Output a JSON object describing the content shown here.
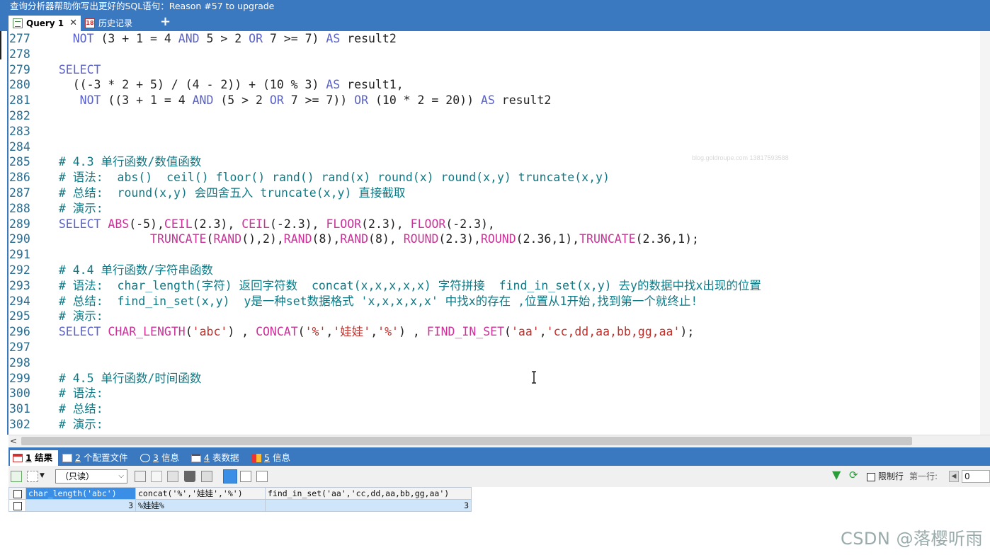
{
  "window": {
    "title": "查询分析器帮助你写出更好的SQL语句：Reason #57 to upgrade"
  },
  "tabs": [
    {
      "label": "Query 1",
      "close": "✕"
    },
    {
      "label": "历史记录",
      "icon_text": "18"
    }
  ],
  "new_tab": "+",
  "editor": {
    "watermark": "blog.goldroupe.com 13817593588",
    "lines": [
      {
        "n": "277",
        "tokens": [
          {
            "t": "    ",
            "c": "pl"
          },
          {
            "t": "NOT",
            "c": "kw"
          },
          {
            "t": " (3 + 1 = 4 ",
            "c": "pl"
          },
          {
            "t": "AND",
            "c": "kw"
          },
          {
            "t": " 5 > 2 ",
            "c": "pl"
          },
          {
            "t": "OR",
            "c": "kw"
          },
          {
            "t": " 7 >= 7) ",
            "c": "pl"
          },
          {
            "t": "AS",
            "c": "kw"
          },
          {
            "t": " result2",
            "c": "pl"
          }
        ]
      },
      {
        "n": "278",
        "tokens": []
      },
      {
        "n": "279",
        "tokens": [
          {
            "t": "  ",
            "c": "pl"
          },
          {
            "t": "SELECT",
            "c": "kw"
          }
        ]
      },
      {
        "n": "280",
        "tokens": [
          {
            "t": "    ((-3 * 2 + 5) / (4 - 2)) + (10 % 3) ",
            "c": "pl"
          },
          {
            "t": "AS",
            "c": "kw"
          },
          {
            "t": " result1,",
            "c": "pl"
          }
        ]
      },
      {
        "n": "281",
        "tokens": [
          {
            "t": "     ",
            "c": "pl"
          },
          {
            "t": "NOT",
            "c": "kw"
          },
          {
            "t": " ((3 + 1 = 4 ",
            "c": "pl"
          },
          {
            "t": "AND",
            "c": "kw"
          },
          {
            "t": " (5 > 2 ",
            "c": "pl"
          },
          {
            "t": "OR",
            "c": "kw"
          },
          {
            "t": " 7 >= 7)) ",
            "c": "pl"
          },
          {
            "t": "OR",
            "c": "kw"
          },
          {
            "t": " (10 * 2 = 20)) ",
            "c": "pl"
          },
          {
            "t": "AS",
            "c": "kw"
          },
          {
            "t": " result2",
            "c": "pl"
          }
        ]
      },
      {
        "n": "282",
        "tokens": []
      },
      {
        "n": "283",
        "tokens": []
      },
      {
        "n": "284",
        "tokens": []
      },
      {
        "n": "285",
        "tokens": [
          {
            "t": "  # 4.3 单行函数/数值函数",
            "c": "cm"
          }
        ]
      },
      {
        "n": "286",
        "tokens": [
          {
            "t": "  # 语法:  abs()  ceil() floor() rand() rand(x) round(x) round(x,y) truncate(x,y)",
            "c": "cm"
          }
        ]
      },
      {
        "n": "287",
        "tokens": [
          {
            "t": "  # 总结:  round(x,y) 会四舍五入 truncate(x,y) 直接截取",
            "c": "cm"
          }
        ]
      },
      {
        "n": "288",
        "tokens": [
          {
            "t": "  # 演示:",
            "c": "cm"
          }
        ]
      },
      {
        "n": "289",
        "tokens": [
          {
            "t": "  ",
            "c": "pl"
          },
          {
            "t": "SELECT",
            "c": "kw"
          },
          {
            "t": " ",
            "c": "pl"
          },
          {
            "t": "ABS",
            "c": "fn"
          },
          {
            "t": "(-5),",
            "c": "pl"
          },
          {
            "t": "CEIL",
            "c": "fn"
          },
          {
            "t": "(2.3), ",
            "c": "pl"
          },
          {
            "t": "CEIL",
            "c": "fn"
          },
          {
            "t": "(-2.3), ",
            "c": "pl"
          },
          {
            "t": "FLOOR",
            "c": "fn"
          },
          {
            "t": "(2.3), ",
            "c": "pl"
          },
          {
            "t": "FLOOR",
            "c": "fn"
          },
          {
            "t": "(-2.3),",
            "c": "pl"
          }
        ]
      },
      {
        "n": "290",
        "tokens": [
          {
            "t": "               ",
            "c": "pl"
          },
          {
            "t": "TRUNCATE",
            "c": "fn"
          },
          {
            "t": "(",
            "c": "pl"
          },
          {
            "t": "RAND",
            "c": "fn"
          },
          {
            "t": "(),2),",
            "c": "pl"
          },
          {
            "t": "RAND",
            "c": "fn"
          },
          {
            "t": "(8),",
            "c": "pl"
          },
          {
            "t": "RAND",
            "c": "fn"
          },
          {
            "t": "(8), ",
            "c": "pl"
          },
          {
            "t": "ROUND",
            "c": "fn"
          },
          {
            "t": "(2.3),",
            "c": "pl"
          },
          {
            "t": "ROUND",
            "c": "fn"
          },
          {
            "t": "(2.36,1),",
            "c": "pl"
          },
          {
            "t": "TRUNCATE",
            "c": "fn"
          },
          {
            "t": "(2.36,1);",
            "c": "pl"
          }
        ]
      },
      {
        "n": "291",
        "tokens": []
      },
      {
        "n": "292",
        "tokens": [
          {
            "t": "  # 4.4 单行函数/字符串函数",
            "c": "cm"
          }
        ]
      },
      {
        "n": "293",
        "tokens": [
          {
            "t": "  # 语法:  char_length(字符) 返回字符数  concat(x,x,x,x,x) 字符拼接  find_in_set(x,y) 去y的数据中找x出现的位置",
            "c": "cm"
          }
        ]
      },
      {
        "n": "294",
        "tokens": [
          {
            "t": "  # 总结:  find_in_set(x,y)  y是一种set数据格式 'x,x,x,x,x' 中找x的存在 ,位置从1开始,找到第一个就终止!",
            "c": "cm"
          }
        ]
      },
      {
        "n": "295",
        "tokens": [
          {
            "t": "  # 演示:",
            "c": "cm"
          }
        ]
      },
      {
        "n": "296",
        "tokens": [
          {
            "t": "  ",
            "c": "pl"
          },
          {
            "t": "SELECT",
            "c": "kw"
          },
          {
            "t": " ",
            "c": "pl"
          },
          {
            "t": "CHAR_LENGTH",
            "c": "fn"
          },
          {
            "t": "(",
            "c": "pl"
          },
          {
            "t": "'abc'",
            "c": "str"
          },
          {
            "t": ") , ",
            "c": "pl"
          },
          {
            "t": "CONCAT",
            "c": "fn"
          },
          {
            "t": "(",
            "c": "pl"
          },
          {
            "t": "'%'",
            "c": "str"
          },
          {
            "t": ",",
            "c": "pl"
          },
          {
            "t": "'娃娃'",
            "c": "str"
          },
          {
            "t": ",",
            "c": "pl"
          },
          {
            "t": "'%'",
            "c": "str"
          },
          {
            "t": ") , ",
            "c": "pl"
          },
          {
            "t": "FIND_IN_SET",
            "c": "fn"
          },
          {
            "t": "(",
            "c": "pl"
          },
          {
            "t": "'aa'",
            "c": "str"
          },
          {
            "t": ",",
            "c": "pl"
          },
          {
            "t": "'cc,dd,aa,bb,gg,aa'",
            "c": "str"
          },
          {
            "t": ");",
            "c": "pl"
          }
        ]
      },
      {
        "n": "297",
        "tokens": []
      },
      {
        "n": "298",
        "tokens": []
      },
      {
        "n": "299",
        "tokens": [
          {
            "t": "  # 4.5 单行函数/时间函数",
            "c": "cm"
          }
        ]
      },
      {
        "n": "300",
        "tokens": [
          {
            "t": "  # 语法:",
            "c": "cm"
          }
        ]
      },
      {
        "n": "301",
        "tokens": [
          {
            "t": "  # 总结:",
            "c": "cm"
          }
        ]
      },
      {
        "n": "302",
        "tokens": [
          {
            "t": "  # 演示:",
            "c": "cm"
          }
        ]
      }
    ]
  },
  "result_tabs": [
    {
      "num": "1",
      "label": "结果"
    },
    {
      "num": "2",
      "label": "个配置文件"
    },
    {
      "num": "3",
      "label": "信息"
    },
    {
      "num": "4",
      "label": "表数据"
    },
    {
      "num": "5",
      "label": "信息"
    }
  ],
  "toolbar": {
    "mode_select": "（只读）",
    "limit_label": "限制行",
    "first_row_label": "第一行:",
    "first_row_value": "0"
  },
  "grid": {
    "columns": [
      "char_length('abc')",
      "concat('%','娃娃','%')",
      "find_in_set('aa','cc,dd,aa,bb,gg,aa')"
    ],
    "rows": [
      [
        "3",
        "%娃娃%",
        "3"
      ]
    ]
  },
  "footer_watermark": "CSDN @落樱听雨",
  "colors": {
    "chrome_blue": "#3a78c0",
    "keyword": "#5a62c8",
    "function": "#cc3399",
    "string": "#c0302a",
    "comment": "#0f7a86"
  }
}
